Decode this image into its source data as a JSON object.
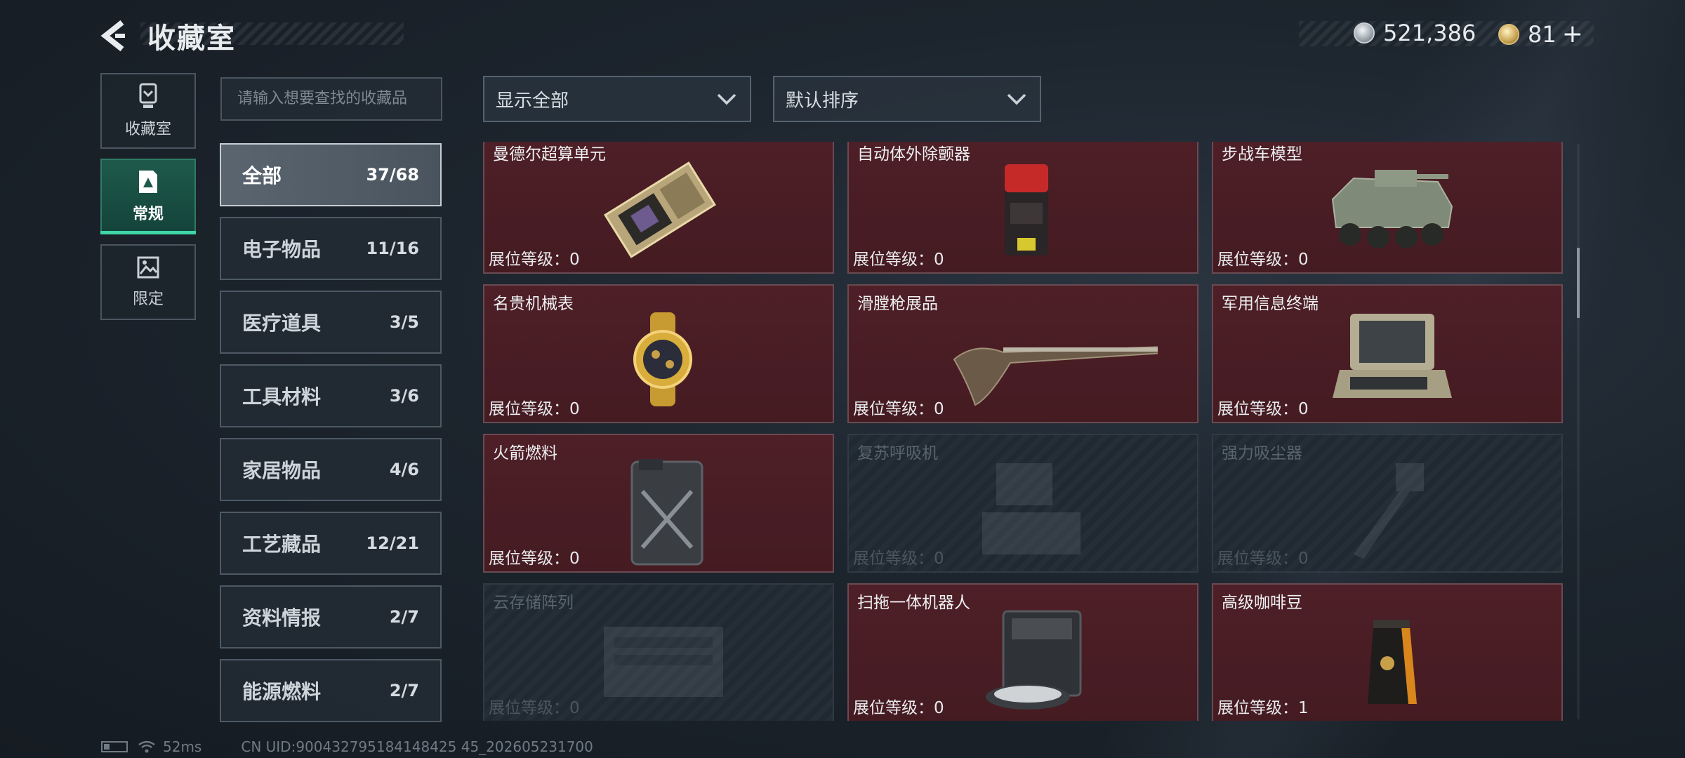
{
  "header": {
    "title": "收藏室",
    "currency_primary": "521,386",
    "currency_secondary": "81",
    "plus": "+"
  },
  "leftnav": [
    {
      "label": "收藏室",
      "icon": "trophy-icon"
    },
    {
      "label": "常规",
      "icon": "document-icon",
      "active": true
    },
    {
      "label": "限定",
      "icon": "image-icon"
    }
  ],
  "search": {
    "placeholder": "请输入想要查找的收藏品"
  },
  "filters": {
    "display": "显示全部",
    "sort": "默认排序"
  },
  "categories": [
    {
      "name": "全部",
      "count": "37/68",
      "active": true
    },
    {
      "name": "电子物品",
      "count": "11/16"
    },
    {
      "name": "医疗道具",
      "count": "3/5"
    },
    {
      "name": "工具材料",
      "count": "3/6"
    },
    {
      "name": "家居物品",
      "count": "4/6"
    },
    {
      "name": "工艺藏品",
      "count": "12/21"
    },
    {
      "name": "资料情报",
      "count": "2/7"
    },
    {
      "name": "能源燃料",
      "count": "2/7"
    }
  ],
  "items": [
    {
      "name": "曼德尔超算单元",
      "level": "展位等级：0",
      "icon": "gpu-card-icon",
      "locked": false
    },
    {
      "name": "自动体外除颤器",
      "level": "展位等级：0",
      "icon": "defibrillator-icon",
      "locked": false
    },
    {
      "name": "步战车模型",
      "level": "展位等级：0",
      "icon": "armored-vehicle-icon",
      "locked": false
    },
    {
      "name": "名贵机械表",
      "level": "展位等级：0",
      "icon": "gold-watch-icon",
      "locked": false
    },
    {
      "name": "滑膛枪展品",
      "level": "展位等级：0",
      "icon": "musket-icon",
      "locked": false
    },
    {
      "name": "军用信息终端",
      "level": "展位等级：0",
      "icon": "rugged-terminal-icon",
      "locked": false
    },
    {
      "name": "火箭燃料",
      "level": "展位等级：0",
      "icon": "fuel-canister-icon",
      "locked": false
    },
    {
      "name": "复苏呼吸机",
      "level": "展位等级：0",
      "icon": "ventilator-icon",
      "locked": true
    },
    {
      "name": "强力吸尘器",
      "level": "展位等级：0",
      "icon": "vacuum-icon",
      "locked": true
    },
    {
      "name": "云存储阵列",
      "level": "展位等级：0",
      "icon": "storage-array-icon",
      "locked": true
    },
    {
      "name": "扫拖一体机器人",
      "level": "展位等级：0",
      "icon": "mop-robot-icon",
      "locked": false
    },
    {
      "name": "高级咖啡豆",
      "level": "展位等级：1",
      "icon": "coffee-bag-icon",
      "locked": false
    }
  ],
  "footer": {
    "ping": "52ms",
    "uid": "CN UID:900432795184148425 45_202605231700"
  },
  "colors": {
    "accent": "#3fd6a6",
    "card_bg": "#4e1f27",
    "locked_bg": "#242e37"
  }
}
